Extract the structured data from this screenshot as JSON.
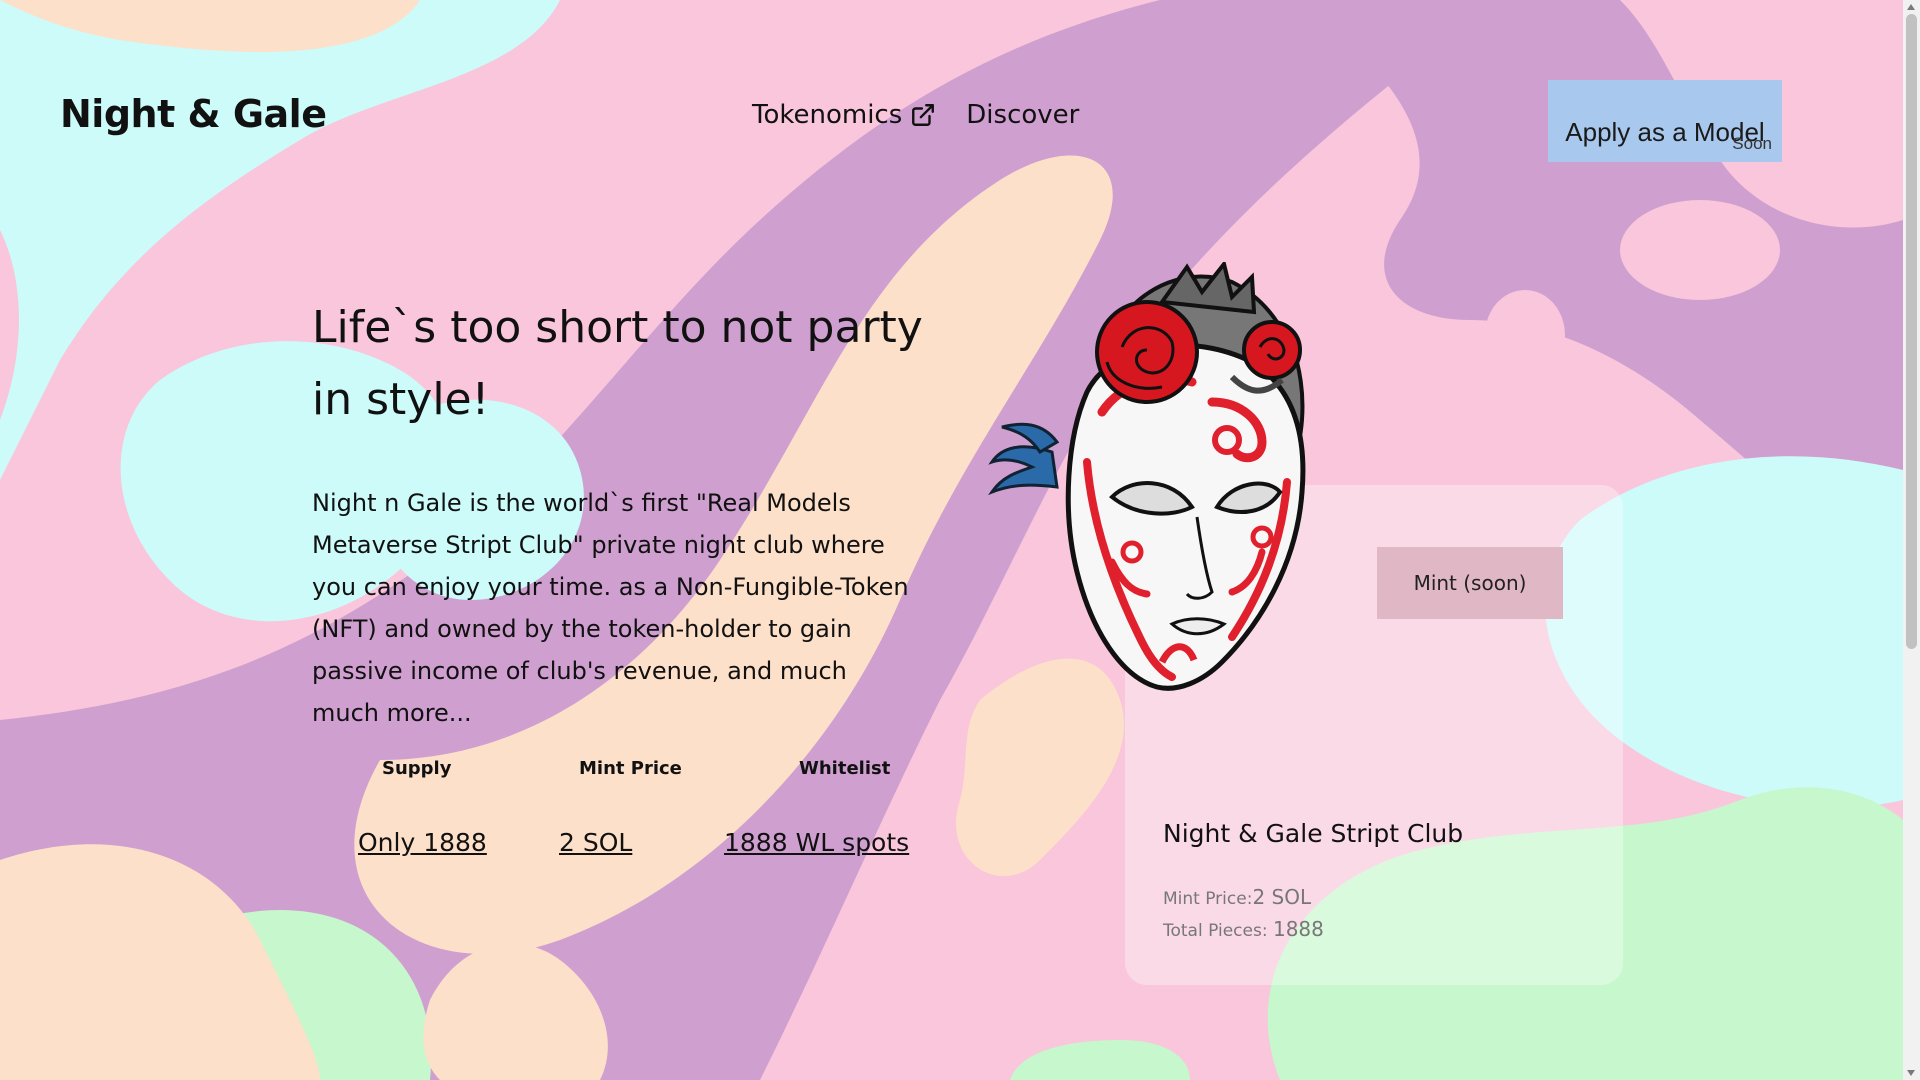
{
  "header": {
    "logo": "Night & Gale",
    "nav": [
      {
        "label": "Tokenomics",
        "icon": "external-link-icon"
      },
      {
        "label": "Discover"
      }
    ],
    "apply_button": {
      "label": "Apply as a Model",
      "badge": "Soon"
    }
  },
  "hero": {
    "headline": "Life`s too short to not party in style!",
    "description": "Night n Gale is the world`s first \"Real Models Metaverse Stript Club\" private night club where you can enjoy your time. as a Non-Fungible-Token (NFT) and owned by the token-holder to gain passive income of club's revenue, and much much more..."
  },
  "stats": [
    {
      "label": "Supply",
      "value": "Only 1888"
    },
    {
      "label": "Mint Price",
      "value": "2 SOL"
    },
    {
      "label": "Whitelist",
      "value": "1888 WL spots"
    }
  ],
  "card": {
    "mint_button": "Mint (soon)",
    "title": "Night & Gale Stript Club",
    "price_label": "Mint Price:",
    "price_value": "2 SOL",
    "pieces_label": "Total Pieces: ",
    "pieces_value": "1888"
  },
  "colors": {
    "apply_button": "#a9c8ee",
    "mint_button": "#dfb7c5",
    "bg_pink": "#f9c6dc",
    "bg_purple": "#cf9fd0",
    "bg_peach": "#fde0c9",
    "bg_cyan": "#ccfbfa",
    "bg_green": "#c7f7cc",
    "mask_red": "#e0202c"
  }
}
